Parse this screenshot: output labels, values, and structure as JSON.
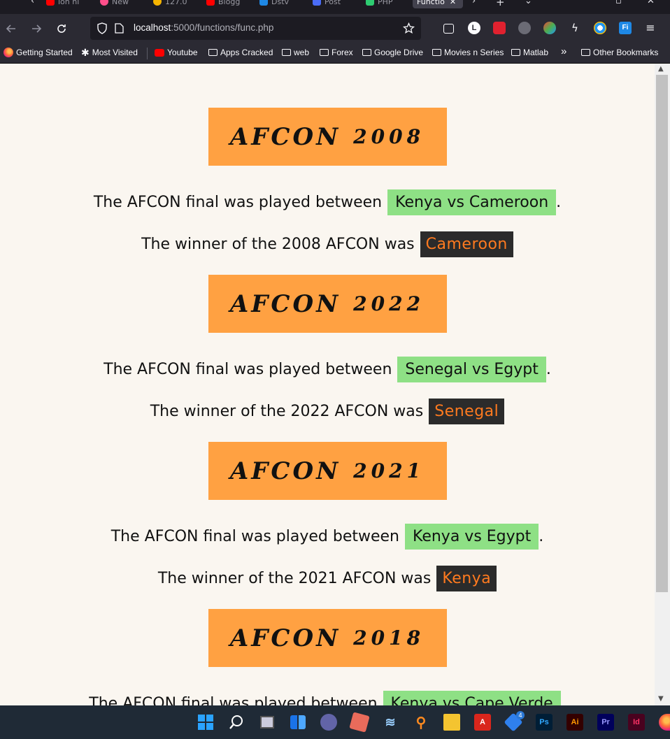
{
  "browser": {
    "tabs": [
      {
        "label": "ion hi",
        "icon": "youtube-icon",
        "color": "#ff0000"
      },
      {
        "label": "New",
        "icon": "firefox-icon",
        "color": "#ff4f8b"
      },
      {
        "label": "127.0",
        "icon": "chrome-icon",
        "color": "#f5b400"
      },
      {
        "label": "Blogg",
        "icon": "youtube-icon",
        "color": "#ff0000"
      },
      {
        "label": "Dstv",
        "icon": "dstv-icon",
        "color": "#1e88e5"
      },
      {
        "label": "Post",
        "icon": "postman-icon",
        "color": "#4a6cf7"
      },
      {
        "label": "PHP",
        "icon": "php-icon",
        "color": "#2ecc71"
      },
      {
        "label": "Functio",
        "icon": "page-icon",
        "color": "#9e9e9e",
        "active": true
      }
    ],
    "url_host": "localhost",
    "url_path": ":5000/functions/func.php",
    "bookmarks": [
      {
        "label": "Getting Started",
        "icon": "firefox-icon"
      },
      {
        "label": "Most Visited",
        "icon": "gear-icon"
      },
      {
        "label": "Youtube",
        "icon": "youtube-icon"
      },
      {
        "label": "Apps Cracked",
        "icon": "folder-icon"
      },
      {
        "label": "web",
        "icon": "folder-icon"
      },
      {
        "label": "Forex",
        "icon": "folder-icon"
      },
      {
        "label": "Google Drive",
        "icon": "folder-icon"
      },
      {
        "label": "Movies n Series",
        "icon": "folder-icon"
      },
      {
        "label": "Matlab",
        "icon": "folder-icon"
      }
    ],
    "more_bookmarks": "»",
    "other_bookmarks": "Other Bookmarks"
  },
  "page": {
    "sections": [
      {
        "heading_word": "AFCON",
        "year": "2008",
        "final_prefix": "The AFCON final was played between",
        "final_match": "Kenya vs Cameroon",
        "final_suffix": ".",
        "winner_prefix": "The winner of the 2008 AFCON was",
        "winner": "Cameroon"
      },
      {
        "heading_word": "AFCON",
        "year": "2022",
        "final_prefix": "The AFCON final was played between",
        "final_match": "Senegal vs Egypt",
        "final_suffix": ".",
        "winner_prefix": "The winner of the 2022 AFCON was",
        "winner": "Senegal"
      },
      {
        "heading_word": "AFCON",
        "year": "2021",
        "final_prefix": "The AFCON final was played between",
        "final_match": "Kenya vs Egypt",
        "final_suffix": ".",
        "winner_prefix": "The winner of the 2021 AFCON was",
        "winner": "Kenya"
      },
      {
        "heading_word": "AFCON",
        "year": "2018",
        "final_prefix": "The AFCON final was played between",
        "final_match": "Kenya vs Cape Verde",
        "final_suffix": ".",
        "winner_prefix": "",
        "winner": ""
      }
    ],
    "colors": {
      "heading_bg": "#ffa142",
      "match_bg": "#8ee085",
      "winner_bg": "#2b2b2b",
      "winner_text": "#ff7a1f",
      "page_bg": "#faf6f0"
    }
  },
  "taskbar": {
    "apps": [
      {
        "name": "start-icon"
      },
      {
        "name": "search-icon"
      },
      {
        "name": "task-view-icon"
      },
      {
        "name": "widgets-icon"
      },
      {
        "name": "teams-chat-icon"
      },
      {
        "name": "package-icon"
      },
      {
        "name": "docker-icon"
      },
      {
        "name": "search-everything-icon"
      },
      {
        "name": "file-explorer-icon"
      },
      {
        "name": "acrobat-icon"
      },
      {
        "name": "vscode-icon",
        "badge": "4"
      },
      {
        "name": "photoshop-icon",
        "label": "Ps"
      },
      {
        "name": "illustrator-icon",
        "label": "Ai"
      },
      {
        "name": "premiere-icon",
        "label": "Pr"
      },
      {
        "name": "indesign-icon",
        "label": "Id"
      },
      {
        "name": "firefox-icon"
      }
    ]
  }
}
